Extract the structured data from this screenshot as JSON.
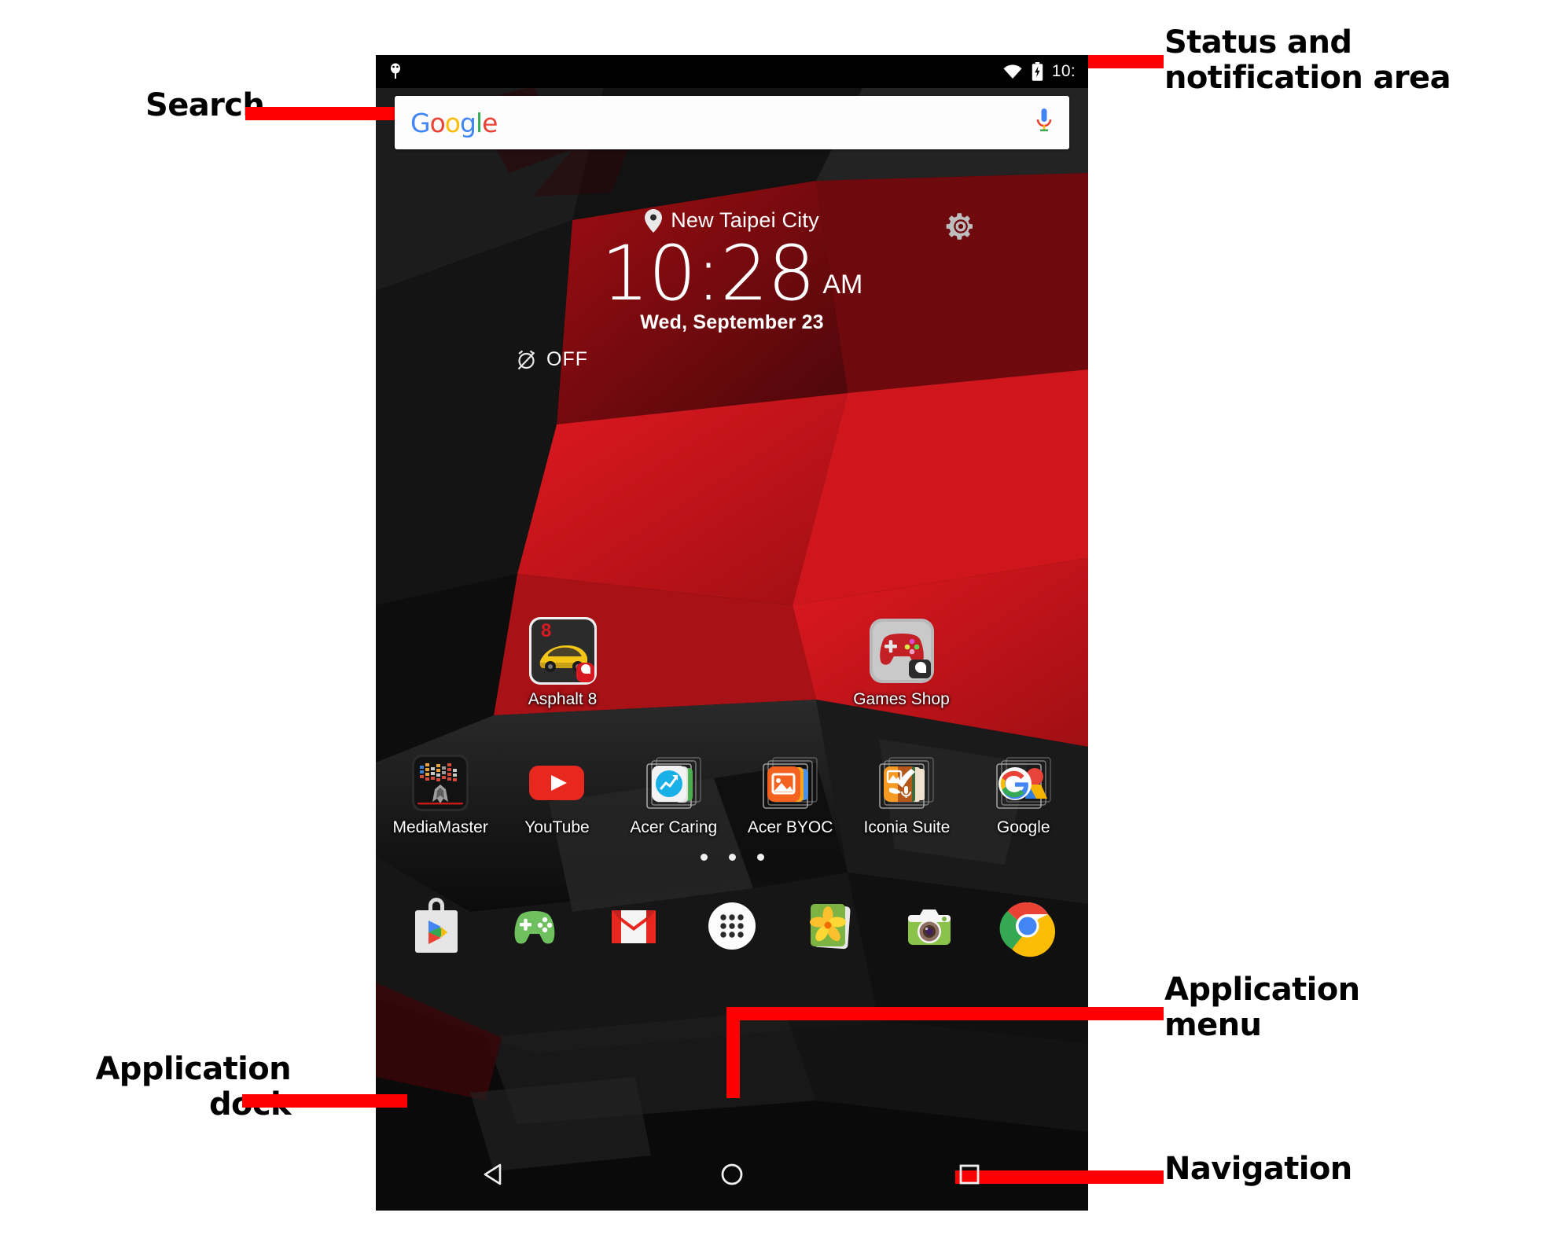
{
  "status_bar": {
    "notification_icon": "android-debug-icon",
    "wifi_icon": "wifi-icon",
    "battery_icon": "battery-charging-icon",
    "time": "10:"
  },
  "search_widget": {
    "logo_text": "Google",
    "logo_letters": [
      "G",
      "o",
      "o",
      "g",
      "l",
      "e"
    ],
    "mic_icon": "microphone-icon",
    "placeholder": ""
  },
  "clock_widget": {
    "location_icon": "location-pin-icon",
    "location": "New Taipei City",
    "time": "10:28",
    "meridiem": "AM",
    "date": "Wed, September 23",
    "alarm_icon": "alarm-off-icon",
    "alarm_status": "OFF",
    "settings_icon": "gear-icon"
  },
  "home_apps": {
    "row_top": [
      {
        "label": "Asphalt 8",
        "icon": "asphalt-8-icon"
      },
      {
        "label": "Games Shop",
        "icon": "games-shop-icon"
      }
    ],
    "row_mid": [
      {
        "label": "MediaMaster",
        "icon": "mediamaster-icon"
      },
      {
        "label": "YouTube",
        "icon": "youtube-icon"
      },
      {
        "label": "Acer Caring",
        "icon": "acer-caring-folder-icon"
      },
      {
        "label": "Acer BYOC",
        "icon": "acer-byoc-folder-icon"
      },
      {
        "label": "Iconia Suite",
        "icon": "iconia-suite-folder-icon"
      },
      {
        "label": "Google",
        "icon": "google-folder-icon"
      }
    ]
  },
  "page_indicator": {
    "count": 3,
    "active_index": 1
  },
  "dock": [
    {
      "name": "play-store-icon"
    },
    {
      "name": "play-games-icon"
    },
    {
      "name": "gmail-icon"
    },
    {
      "name": "app-drawer-icon"
    },
    {
      "name": "gallery-icon"
    },
    {
      "name": "camera-icon"
    },
    {
      "name": "chrome-icon"
    }
  ],
  "navigation": [
    {
      "name": "back-button"
    },
    {
      "name": "home-button"
    },
    {
      "name": "recents-button"
    }
  ],
  "annotations": [
    {
      "id": "search",
      "text": "Search"
    },
    {
      "id": "status",
      "text": "Status and\nnotification area"
    },
    {
      "id": "appmenu",
      "text": "Application\nmenu"
    },
    {
      "id": "appdock",
      "text": "Application\ndock"
    },
    {
      "id": "navigation",
      "text": "Navigation"
    }
  ],
  "colors": {
    "callout": "#FF0000",
    "wallpaper_red": "#C8151B",
    "wallpaper_dark": "#151515",
    "screen_black": "#000000"
  }
}
